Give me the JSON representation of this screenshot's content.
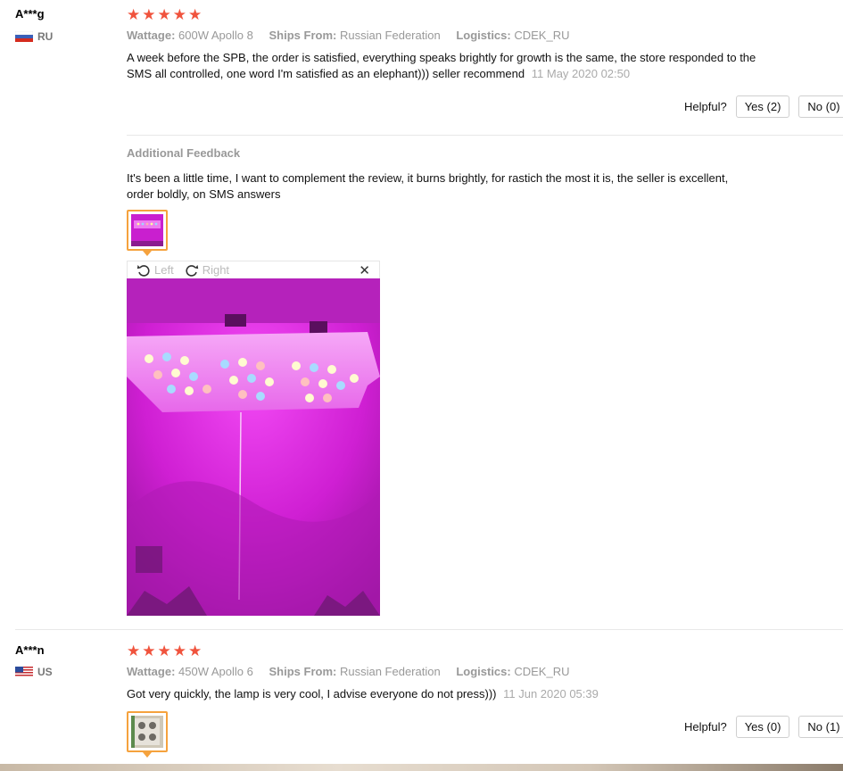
{
  "reviews": [
    {
      "username": "A***g",
      "country_code": "RU",
      "rating": 5,
      "attributes": [
        {
          "label": "Wattage:",
          "value": "600W Apollo 8"
        },
        {
          "label": "Ships From:",
          "value": "Russian Federation"
        },
        {
          "label": "Logistics:",
          "value": "CDEK_RU"
        }
      ],
      "text": "A week before the SPB, the order is satisfied, everything speaks brightly for growth is the same, the store responded to the SMS all controlled, one word I'm satisfied as an elephant))) seller recommend",
      "date": "11 May 2020 02:50",
      "helpful_label": "Helpful?",
      "yes_label": "Yes (2)",
      "no_label": "No (0)",
      "additional_feedback": {
        "title": "Additional Feedback",
        "text": "It's been a little time, I want to complement the review, it burns brightly, for rastich the most it is, the seller is excellent, order boldly, on SMS answers"
      },
      "viewer": {
        "rotate_left_label": "Left",
        "rotate_right_label": "Right",
        "close_icon": "close-icon"
      }
    },
    {
      "username": "A***n",
      "country_code": "US",
      "rating": 5,
      "attributes": [
        {
          "label": "Wattage:",
          "value": "450W Apollo 6"
        },
        {
          "label": "Ships From:",
          "value": "Russian Federation"
        },
        {
          "label": "Logistics:",
          "value": "CDEK_RU"
        }
      ],
      "text": "Got very quickly, the lamp is very cool, I advise everyone do not press)))",
      "date": "11 Jun 2020 05:39",
      "helpful_label": "Helpful?",
      "yes_label": "Yes (0)",
      "no_label": "No (1)"
    }
  ],
  "colors": {
    "star": "#f0533d",
    "thumb_border": "#f5a23d",
    "muted_text": "#999999",
    "grow_light": "#d21cd6"
  }
}
